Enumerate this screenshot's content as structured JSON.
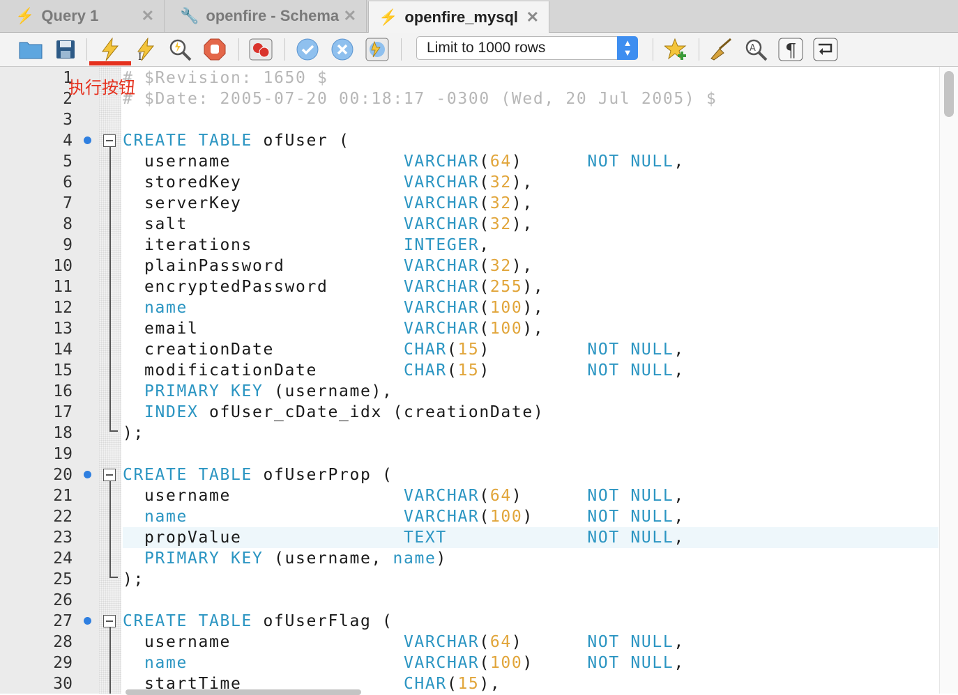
{
  "tabs": [
    {
      "label": "Query 1",
      "close": "✕"
    },
    {
      "label": "openfire - Schema",
      "close": "✕"
    },
    {
      "label": "openfire_mysql",
      "close": "✕"
    }
  ],
  "toolbar": {
    "limit_select": "Limit to 1000 rows"
  },
  "annotation": "执行按钮",
  "editor": {
    "line_numbers": [
      "1",
      "2",
      "3",
      "4",
      "5",
      "6",
      "7",
      "8",
      "9",
      "10",
      "11",
      "12",
      "13",
      "14",
      "15",
      "16",
      "17",
      "18",
      "19",
      "20",
      "21",
      "22",
      "23",
      "24",
      "25",
      "26",
      "27",
      "28",
      "29",
      "30"
    ],
    "lines": [
      [
        {
          "t": "# $Revision: 1650 $",
          "c": "cm"
        }
      ],
      [
        {
          "t": "# $Date: 2005-07-20 00:18:17 -0300 (Wed, 20 Jul 2005) $",
          "c": "cm"
        }
      ],
      [],
      [
        {
          "t": "CREATE TABLE ",
          "c": "kw"
        },
        {
          "t": "ofUser (",
          "c": "id"
        }
      ],
      [
        {
          "t": "  username                ",
          "c": "id"
        },
        {
          "t": "VARCHAR",
          "c": "kw"
        },
        {
          "t": "(",
          "c": "p"
        },
        {
          "t": "64",
          "c": "num"
        },
        {
          "t": ")      ",
          "c": "p"
        },
        {
          "t": "NOT NULL",
          "c": "kw"
        },
        {
          "t": ",",
          "c": "p"
        }
      ],
      [
        {
          "t": "  storedKey               ",
          "c": "id"
        },
        {
          "t": "VARCHAR",
          "c": "kw"
        },
        {
          "t": "(",
          "c": "p"
        },
        {
          "t": "32",
          "c": "num"
        },
        {
          "t": "),",
          "c": "p"
        }
      ],
      [
        {
          "t": "  serverKey               ",
          "c": "id"
        },
        {
          "t": "VARCHAR",
          "c": "kw"
        },
        {
          "t": "(",
          "c": "p"
        },
        {
          "t": "32",
          "c": "num"
        },
        {
          "t": "),",
          "c": "p"
        }
      ],
      [
        {
          "t": "  salt                    ",
          "c": "id"
        },
        {
          "t": "VARCHAR",
          "c": "kw"
        },
        {
          "t": "(",
          "c": "p"
        },
        {
          "t": "32",
          "c": "num"
        },
        {
          "t": "),",
          "c": "p"
        }
      ],
      [
        {
          "t": "  iterations              ",
          "c": "id"
        },
        {
          "t": "INTEGER",
          "c": "kw"
        },
        {
          "t": ",",
          "c": "p"
        }
      ],
      [
        {
          "t": "  plainPassword           ",
          "c": "id"
        },
        {
          "t": "VARCHAR",
          "c": "kw"
        },
        {
          "t": "(",
          "c": "p"
        },
        {
          "t": "32",
          "c": "num"
        },
        {
          "t": "),",
          "c": "p"
        }
      ],
      [
        {
          "t": "  encryptedPassword       ",
          "c": "id"
        },
        {
          "t": "VARCHAR",
          "c": "kw"
        },
        {
          "t": "(",
          "c": "p"
        },
        {
          "t": "255",
          "c": "num"
        },
        {
          "t": "),",
          "c": "p"
        }
      ],
      [
        {
          "t": "  ",
          "c": "id"
        },
        {
          "t": "name",
          "c": "kw"
        },
        {
          "t": "                    ",
          "c": "id"
        },
        {
          "t": "VARCHAR",
          "c": "kw"
        },
        {
          "t": "(",
          "c": "p"
        },
        {
          "t": "100",
          "c": "num"
        },
        {
          "t": "),",
          "c": "p"
        }
      ],
      [
        {
          "t": "  email                   ",
          "c": "id"
        },
        {
          "t": "VARCHAR",
          "c": "kw"
        },
        {
          "t": "(",
          "c": "p"
        },
        {
          "t": "100",
          "c": "num"
        },
        {
          "t": "),",
          "c": "p"
        }
      ],
      [
        {
          "t": "  creationDate            ",
          "c": "id"
        },
        {
          "t": "CHAR",
          "c": "kw"
        },
        {
          "t": "(",
          "c": "p"
        },
        {
          "t": "15",
          "c": "num"
        },
        {
          "t": ")         ",
          "c": "p"
        },
        {
          "t": "NOT NULL",
          "c": "kw"
        },
        {
          "t": ",",
          "c": "p"
        }
      ],
      [
        {
          "t": "  modificationDate        ",
          "c": "id"
        },
        {
          "t": "CHAR",
          "c": "kw"
        },
        {
          "t": "(",
          "c": "p"
        },
        {
          "t": "15",
          "c": "num"
        },
        {
          "t": ")         ",
          "c": "p"
        },
        {
          "t": "NOT NULL",
          "c": "kw"
        },
        {
          "t": ",",
          "c": "p"
        }
      ],
      [
        {
          "t": "  ",
          "c": "id"
        },
        {
          "t": "PRIMARY KEY",
          "c": "kw"
        },
        {
          "t": " (username),",
          "c": "id"
        }
      ],
      [
        {
          "t": "  ",
          "c": "id"
        },
        {
          "t": "INDEX",
          "c": "kw"
        },
        {
          "t": " ofUser_cDate_idx (creationDate)",
          "c": "id"
        }
      ],
      [
        {
          "t": ");",
          "c": "p"
        }
      ],
      [],
      [
        {
          "t": "CREATE TABLE ",
          "c": "kw"
        },
        {
          "t": "ofUserProp (",
          "c": "id"
        }
      ],
      [
        {
          "t": "  username                ",
          "c": "id"
        },
        {
          "t": "VARCHAR",
          "c": "kw"
        },
        {
          "t": "(",
          "c": "p"
        },
        {
          "t": "64",
          "c": "num"
        },
        {
          "t": ")      ",
          "c": "p"
        },
        {
          "t": "NOT NULL",
          "c": "kw"
        },
        {
          "t": ",",
          "c": "p"
        }
      ],
      [
        {
          "t": "  ",
          "c": "id"
        },
        {
          "t": "name",
          "c": "kw"
        },
        {
          "t": "                    ",
          "c": "id"
        },
        {
          "t": "VARCHAR",
          "c": "kw"
        },
        {
          "t": "(",
          "c": "p"
        },
        {
          "t": "100",
          "c": "num"
        },
        {
          "t": ")     ",
          "c": "p"
        },
        {
          "t": "NOT NULL",
          "c": "kw"
        },
        {
          "t": ",",
          "c": "p"
        }
      ],
      [
        {
          "t": "  propValue               ",
          "c": "id"
        },
        {
          "t": "TEXT",
          "c": "kw"
        },
        {
          "t": "             ",
          "c": "p"
        },
        {
          "t": "NOT NULL",
          "c": "kw"
        },
        {
          "t": ",",
          "c": "p"
        }
      ],
      [
        {
          "t": "  ",
          "c": "id"
        },
        {
          "t": "PRIMARY KEY",
          "c": "kw"
        },
        {
          "t": " (username, ",
          "c": "id"
        },
        {
          "t": "name",
          "c": "kw"
        },
        {
          "t": ")",
          "c": "id"
        }
      ],
      [
        {
          "t": ");",
          "c": "p"
        }
      ],
      [],
      [
        {
          "t": "CREATE TABLE ",
          "c": "kw"
        },
        {
          "t": "ofUserFlag (",
          "c": "id"
        }
      ],
      [
        {
          "t": "  username                ",
          "c": "id"
        },
        {
          "t": "VARCHAR",
          "c": "kw"
        },
        {
          "t": "(",
          "c": "p"
        },
        {
          "t": "64",
          "c": "num"
        },
        {
          "t": ")      ",
          "c": "p"
        },
        {
          "t": "NOT NULL",
          "c": "kw"
        },
        {
          "t": ",",
          "c": "p"
        }
      ],
      [
        {
          "t": "  ",
          "c": "id"
        },
        {
          "t": "name",
          "c": "kw"
        },
        {
          "t": "                    ",
          "c": "id"
        },
        {
          "t": "VARCHAR",
          "c": "kw"
        },
        {
          "t": "(",
          "c": "p"
        },
        {
          "t": "100",
          "c": "num"
        },
        {
          "t": ")     ",
          "c": "p"
        },
        {
          "t": "NOT NULL",
          "c": "kw"
        },
        {
          "t": ",",
          "c": "p"
        }
      ],
      [
        {
          "t": "  startTime               ",
          "c": "id"
        },
        {
          "t": "CHAR",
          "c": "kw"
        },
        {
          "t": "(",
          "c": "p"
        },
        {
          "t": "15",
          "c": "num"
        },
        {
          "t": "),",
          "c": "p"
        }
      ]
    ]
  }
}
